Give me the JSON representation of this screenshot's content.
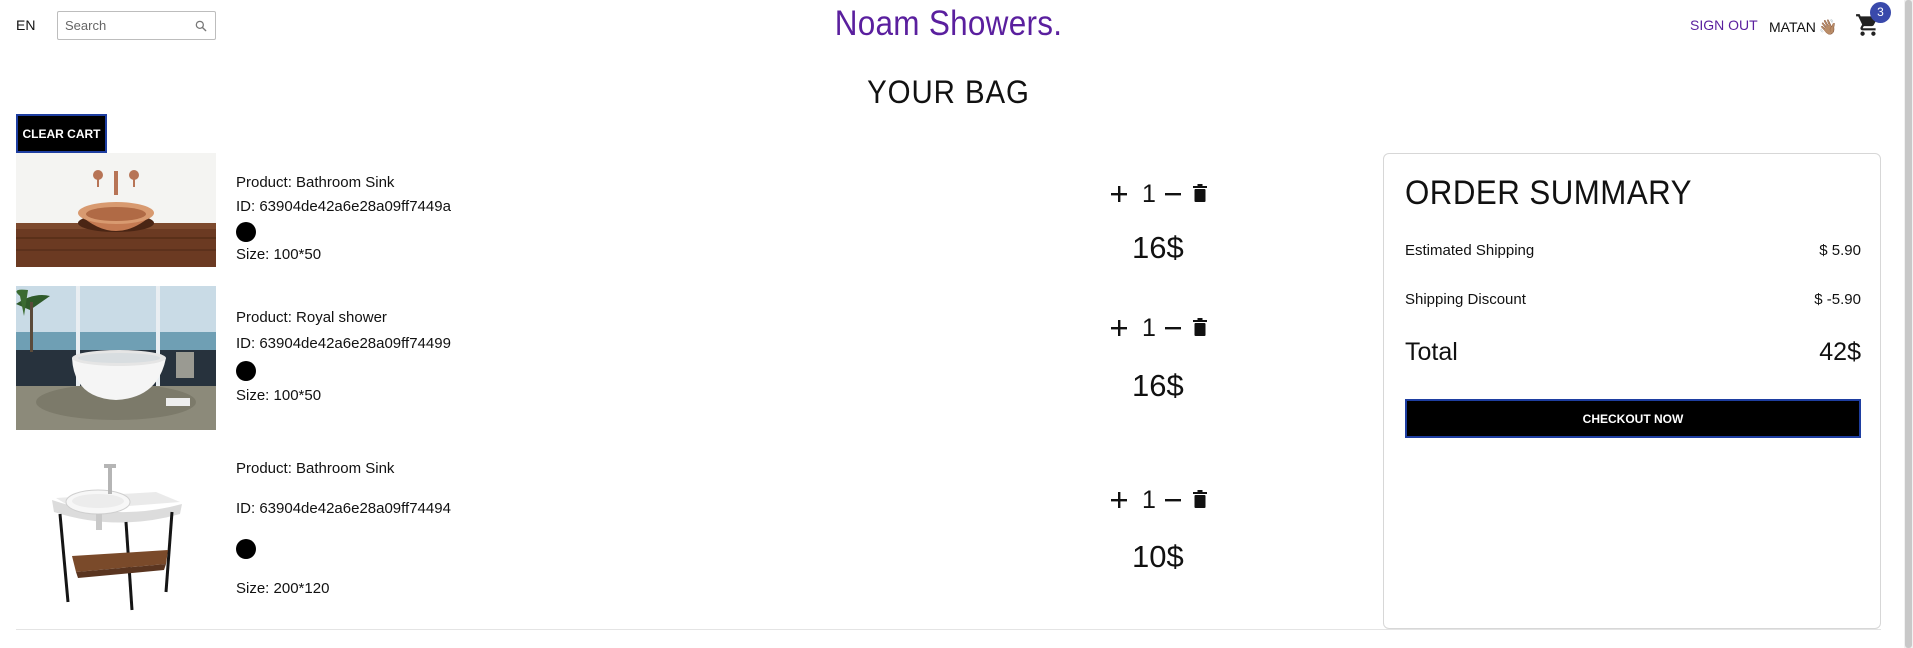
{
  "header": {
    "language": "EN",
    "search_placeholder": "Search",
    "brand": "Noam Showers.",
    "sign_out": "SIGN OUT",
    "user_name": "MATAN",
    "user_emoji": "👋🏽",
    "cart_count": "3"
  },
  "page": {
    "title": "YOUR BAG",
    "clear_cart": "CLEAR CART"
  },
  "items": [
    {
      "product": "Product: Bathroom Sink",
      "id": "ID: 63904de42a6e28a09ff7449a",
      "size": "Size: 100*50",
      "quantity": "1",
      "price": "16$",
      "color": "#000000"
    },
    {
      "product": "Product: Royal shower",
      "id": "ID: 63904de42a6e28a09ff74499",
      "size": "Size: 100*50",
      "quantity": "1",
      "price": "16$",
      "color": "#000000"
    },
    {
      "product": "Product: Bathroom Sink",
      "id": "ID: 63904de42a6e28a09ff74494",
      "size": "Size: 200*120",
      "quantity": "1",
      "price": "10$",
      "color": "#000000"
    }
  ],
  "summary": {
    "title": "ORDER SUMMARY",
    "shipping_label": "Estimated Shipping",
    "shipping_value": "$ 5.90",
    "discount_label": "Shipping Discount",
    "discount_value": "$ -5.90",
    "total_label": "Total",
    "total_value": "42$",
    "checkout": "CHECKOUT NOW"
  },
  "colors": {
    "brand": "#5a1f9e",
    "badge": "#3949ab",
    "button": "#000000"
  }
}
